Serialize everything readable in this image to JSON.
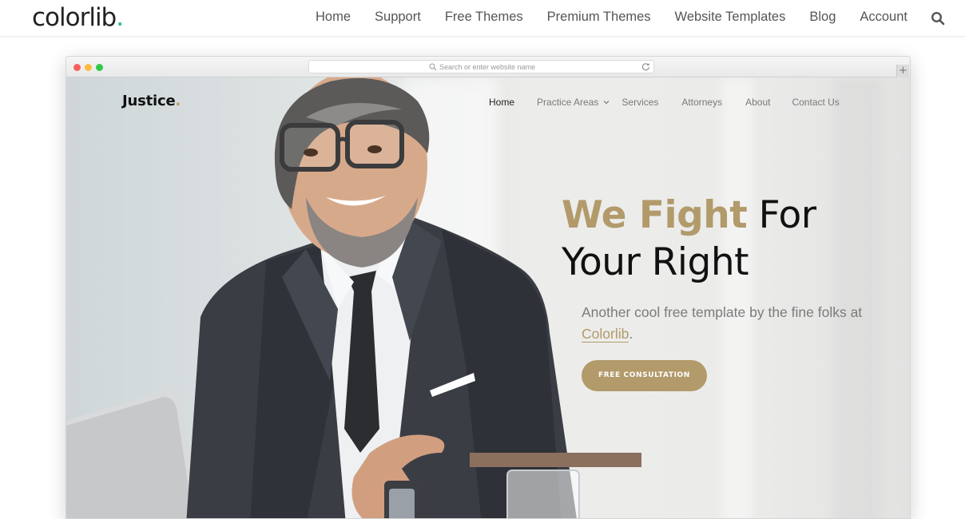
{
  "colorlib": {
    "logo_text": "colorlib",
    "logo_dot": ".",
    "nav": [
      {
        "label": "Home"
      },
      {
        "label": "Support"
      },
      {
        "label": "Free Themes"
      },
      {
        "label": "Premium Themes"
      },
      {
        "label": "Website Templates"
      },
      {
        "label": "Blog"
      },
      {
        "label": "Account"
      }
    ],
    "search_icon": "search-icon"
  },
  "browser": {
    "url_placeholder": "Search or enter website name",
    "newtab_glyph": "+"
  },
  "site": {
    "brand": "Justice",
    "brand_dot": ".",
    "nav": {
      "home": "Home",
      "practice_areas": "Practice Areas",
      "services": "Services",
      "attorneys": "Attorneys",
      "about": "About",
      "contact": "Contact Us"
    },
    "hero": {
      "headline_accent": "We Fight",
      "headline_rest_1": " For",
      "headline_rest_2": "Your Right",
      "subtitle_1": "Another cool free template by the fine folks at ",
      "subtitle_link": "Colorlib",
      "subtitle_end": ".",
      "cta": "FREE CONSULTATION"
    }
  },
  "colors": {
    "accent": "#b29a6a",
    "colorlib_green": "#1abc6c",
    "text_dark": "#111111",
    "text_muted": "#7b7b7b"
  }
}
